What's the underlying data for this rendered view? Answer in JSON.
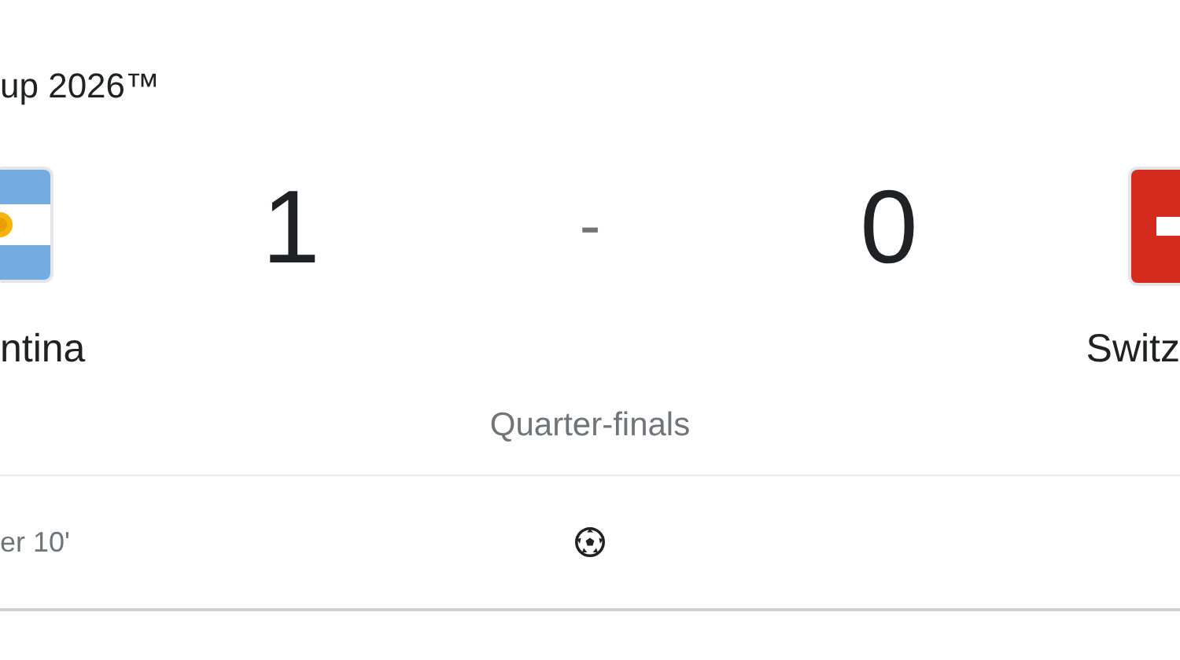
{
  "title": "up 2026™",
  "home": {
    "name": "ntina",
    "score": "1",
    "flag": {
      "kind": "argentina"
    }
  },
  "separator": "-",
  "away": {
    "name": "Switz",
    "score": "0",
    "flag": {
      "kind": "switzerland"
    }
  },
  "stage": "Quarter-finals",
  "events": [
    {
      "text": "er 10'",
      "kind": "goal"
    }
  ]
}
